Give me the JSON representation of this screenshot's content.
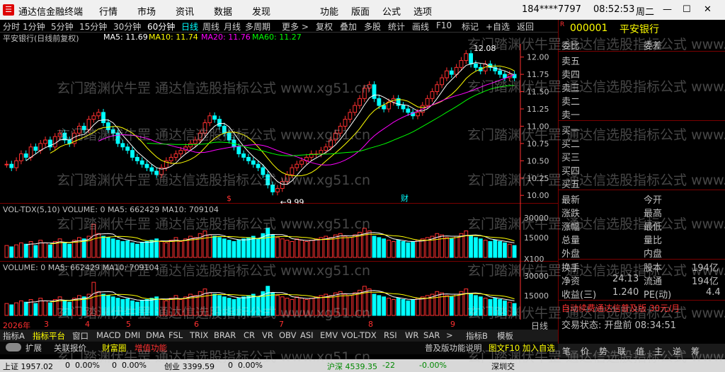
{
  "window": {
    "title": "通达信金融终端",
    "menu": [
      "行情",
      "市场",
      "资讯",
      "数据",
      "发现",
      "功能",
      "版面",
      "公式",
      "选项"
    ],
    "user": "184****7797",
    "time": "08:52:53",
    "weekday": "周二"
  },
  "toolbar": [
    "分时",
    "1分钟",
    "5分钟",
    "15分钟",
    "30分钟",
    "60分钟",
    "日线",
    "周线",
    "月线",
    "多周期",
    "更多 >",
    "复权",
    "叠加",
    "多股",
    "统计",
    "画线",
    "F10",
    "标记",
    "+自选",
    "返回"
  ],
  "stock_legend": {
    "name": "平安银行(日线前复权)",
    "ma5": "MA5: 11.69",
    "ma10": "MA10: 11.74",
    "ma20": "MA20: 11.76",
    "ma60": "MA60: 11.27"
  },
  "price_axis": [
    "12.00",
    "11.75",
    "11.50",
    "11.25",
    "11.00",
    "10.75",
    "10.50",
    "10.25",
    "10.00"
  ],
  "annotations": {
    "high": "12.08",
    "low": "9.99",
    "marker_s": "$",
    "marker_cai": "财"
  },
  "vol_tdx_legend": "VOL-TDX(5,10)  VOLUME: 0  MA5: 662429  MA10: 709104",
  "vol_legend": "VOLUME: 0  MA5: 662429  MA10: 709104",
  "vol_axis": [
    "30000",
    "15000",
    "X100"
  ],
  "vol2_axis": [
    "30000",
    "15000"
  ],
  "x_axis": [
    "2026年",
    "3",
    "4",
    "5",
    "6",
    "7",
    "8",
    "9"
  ],
  "x_right_label": "日线",
  "tabs_row1": [
    "指标A",
    "指标平台",
    "窗口",
    "MACD",
    "DMI",
    "DMA",
    "FSL",
    "TRIX",
    "BRAR",
    "CR",
    "VR",
    "OBV",
    "ASI",
    "EMV",
    "VOL-TDX",
    "RSI",
    "WR",
    "SAR",
    ">",
    "指标B",
    "模板"
  ],
  "tabs_row2": [
    "扩展",
    "关联报价",
    "财富圈",
    "增值功能",
    "普及版功能说明",
    "图文F10 加入自选"
  ],
  "quote": {
    "code": "000001",
    "name": "平安银行",
    "weibi": "委比",
    "weicha": "委差",
    "sell": [
      "卖五",
      "卖四",
      "卖三",
      "卖二",
      "卖一"
    ],
    "buy": [
      "买一",
      "买二",
      "买三",
      "买四",
      "买五"
    ],
    "stats_left": [
      "最新",
      "涨跌",
      "涨幅",
      "总量",
      "外盘"
    ],
    "stats_right": [
      "今开",
      "最高",
      "最低",
      "量比",
      "内盘"
    ],
    "fin": [
      {
        "l": "换手",
        "lv": "",
        "r": "股本",
        "rv": "194亿"
      },
      {
        "l": "净资",
        "lv": "24.13",
        "r": "流通",
        "rv": "194亿"
      },
      {
        "l": "收益(三)",
        "lv": "1.240",
        "r": "PE(动)",
        "rv": "4.4"
      }
    ],
    "ad": "自动续费通达信普及版 30元/月",
    "trade_status": "交易状态: 开盘前 08:34:51"
  },
  "right_tools": [
    "笔",
    "价",
    "势",
    "联",
    "值",
    "主",
    "逆",
    "筹"
  ],
  "status_bar": {
    "sh": "上证 1957.02",
    "v1": "0",
    "p1": "0.00%",
    "v2": "0",
    "p2": "0.00%",
    "cy": "创业 3399.59",
    "v3": "0",
    "p3": "0.00%",
    "hs": "沪深 4539.35",
    "v4": "-22",
    "p4": "-0.00%",
    "sc": "深圳交"
  },
  "watermark": "玄门踏渊伏牛罡 通达信选股指标公式 www.xg51.cn",
  "colors": {
    "up": "#ff3030",
    "down": "#00ffff",
    "ma5": "#ffffff",
    "ma10": "#ffff00",
    "ma20": "#ff00ff",
    "ma60": "#00ff00",
    "axis": "#ff3030"
  },
  "chart_data": {
    "type": "candlestick",
    "ylim": [
      9.9,
      12.15
    ],
    "close": [
      10.45,
      10.4,
      10.5,
      10.6,
      10.55,
      10.7,
      10.65,
      10.75,
      10.8,
      10.7,
      10.85,
      10.9,
      10.8,
      10.75,
      10.9,
      11.0,
      10.95,
      11.1,
      11.15,
      11.2,
      11.05,
      10.95,
      10.9,
      10.75,
      10.7,
      10.65,
      10.55,
      10.5,
      10.45,
      10.4,
      10.35,
      10.3,
      10.4,
      10.5,
      10.55,
      10.6,
      10.65,
      10.7,
      10.75,
      10.8,
      10.9,
      11.05,
      11.15,
      11.1,
      11.0,
      10.9,
      10.8,
      10.7,
      10.6,
      10.55,
      10.5,
      10.45,
      10.4,
      10.3,
      10.15,
      10.05,
      10.1,
      10.2,
      10.3,
      10.4,
      10.45,
      10.5,
      10.55,
      10.6,
      10.6,
      10.65,
      10.7,
      10.8,
      10.9,
      11.0,
      11.1,
      11.2,
      11.3,
      11.4,
      11.55,
      11.6,
      11.4,
      11.3,
      11.25,
      11.35,
      11.4,
      11.3,
      11.25,
      11.2,
      11.15,
      11.2,
      11.3,
      11.4,
      11.5,
      11.6,
      11.7,
      11.8,
      11.75,
      11.85,
      11.95,
      12.05,
      11.9,
      11.85,
      11.8,
      11.9,
      11.85,
      11.8,
      11.75,
      11.7,
      11.75,
      11.7
    ],
    "volume": [
      9000,
      8000,
      9500,
      11000,
      10000,
      12000,
      9000,
      13000,
      11000,
      9500,
      12000,
      14000,
      11000,
      10000,
      13000,
      15000,
      14000,
      16000,
      25000,
      18000,
      16000,
      15000,
      14000,
      13000,
      12000,
      12500,
      11000,
      10000,
      11500,
      12000,
      13000,
      14000,
      12000,
      11000,
      13000,
      15000,
      12000,
      14000,
      16000,
      15000,
      18000,
      20000,
      17000,
      16000,
      15000,
      14000,
      13000,
      12000,
      13000,
      14000,
      15000,
      16000,
      14000,
      18000,
      22000,
      17000,
      15000,
      14000,
      13000,
      12000,
      14000,
      13000,
      12000,
      13000,
      14000,
      15000,
      16000,
      15000,
      17000,
      18000,
      16000,
      15000,
      17000,
      19000,
      22000,
      20000,
      16000,
      15000,
      14000,
      13000,
      12000,
      13000,
      12000,
      11000,
      12000,
      13000,
      14000,
      15000,
      16000,
      18000,
      17000,
      15000,
      14000,
      16000,
      18000,
      20000,
      16000,
      15000,
      14000,
      13000,
      12000,
      13000,
      12000,
      11000,
      10000,
      9000
    ]
  }
}
